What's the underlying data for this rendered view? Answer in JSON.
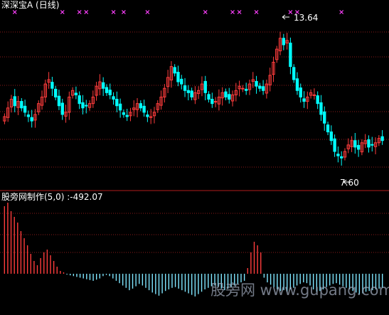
{
  "header": {
    "title": "深深宝A (日线)"
  },
  "indicator": {
    "label": "股旁网制作(5,0)  :-492.07"
  },
  "annotations": {
    "high": "13.64",
    "low": "7.60"
  },
  "watermark": "股旁网 www.gupang.com",
  "colors": {
    "background": "#000000",
    "up": "#ff3c3c",
    "down": "#00ffff",
    "grid": "#8b1a1a",
    "divider": "#b01c1c",
    "marker": "#ff40ff",
    "bar_positive": "#ff3c3c",
    "bar_negative": "#7fe6ff",
    "text": "#ffffff"
  },
  "chart_data": [
    {
      "type": "candlestick",
      "title": "深深宝A (日线)",
      "ylim": [
        6.5,
        14.6
      ],
      "annotations": [
        {
          "text": "13.64",
          "value": 13.64,
          "type": "high"
        },
        {
          "text": "7.60",
          "value": 7.6,
          "type": "low"
        }
      ],
      "buy_marker_count": 14,
      "closes": [
        9.7,
        10.1,
        10.5,
        10.2,
        10.4,
        10.1,
        9.9,
        9.7,
        9.5,
        9.8,
        10.3,
        10.6,
        11.2,
        11.4,
        11.0,
        10.6,
        10.2,
        9.8,
        9.9,
        10.6,
        10.9,
        10.7,
        10.3,
        10.1,
        10.2,
        10.3,
        10.6,
        11.1,
        11.3,
        11.0,
        10.8,
        10.7,
        10.5,
        10.2,
        10.0,
        9.8,
        9.7,
        9.9,
        10.1,
        10.3,
        10.1,
        9.9,
        9.7,
        9.7,
        9.9,
        10.3,
        10.6,
        11.0,
        11.5,
        12.0,
        11.7,
        11.3,
        11.2,
        10.9,
        10.8,
        10.6,
        10.8,
        10.9,
        11.2,
        10.8,
        10.5,
        10.3,
        10.4,
        10.6,
        10.8,
        10.6,
        10.5,
        10.7,
        10.9,
        11.1,
        11.0,
        10.9,
        11.2,
        11.4,
        11.1,
        11.0,
        10.9,
        11.2,
        11.6,
        12.2,
        12.8,
        13.3,
        13.0,
        13.2,
        12.0,
        11.4,
        10.9,
        10.6,
        10.4,
        10.6,
        10.8,
        10.7,
        10.3,
        9.8,
        9.4,
        9.0,
        8.6,
        8.1,
        7.9,
        7.8,
        8.1,
        8.4,
        8.6,
        8.3,
        8.2,
        8.5,
        8.6,
        8.3,
        8.4,
        8.5,
        8.7,
        8.6
      ],
      "indicator": {
        "name": "股旁网制作",
        "params": "(5,0)",
        "last_value": -492.07,
        "values": [
          95,
          100,
          88,
          80,
          72,
          60,
          50,
          40,
          28,
          18,
          12,
          22,
          30,
          34,
          26,
          18,
          10,
          4,
          2,
          -2,
          -4,
          -6,
          -8,
          -10,
          -12,
          -14,
          -16,
          -18,
          -15,
          -12,
          -6,
          -3,
          -6,
          -12,
          -18,
          -24,
          -30,
          -36,
          -42,
          -38,
          -32,
          -26,
          -30,
          -36,
          -42,
          -48,
          -52,
          -56,
          -50,
          -44,
          -40,
          -36,
          -34,
          -38,
          -42,
          -46,
          -50,
          -54,
          -58,
          -52,
          -46,
          -40,
          -36,
          -32,
          -30,
          -34,
          -38,
          -42,
          -38,
          -34,
          -30,
          -26,
          -22,
          -18,
          8,
          30,
          45,
          40,
          30,
          -10,
          -22,
          -28,
          -34,
          -40,
          -44,
          -42,
          -46,
          -40,
          -36,
          -30,
          -26,
          -22,
          -24,
          -30,
          -40,
          -46,
          -44,
          -40,
          -34,
          -30,
          -26,
          -24,
          -28,
          -32,
          -36,
          -40,
          -44,
          -48,
          -52,
          -50,
          -46,
          -44,
          -42,
          -40,
          -38,
          -36
        ]
      }
    }
  ]
}
